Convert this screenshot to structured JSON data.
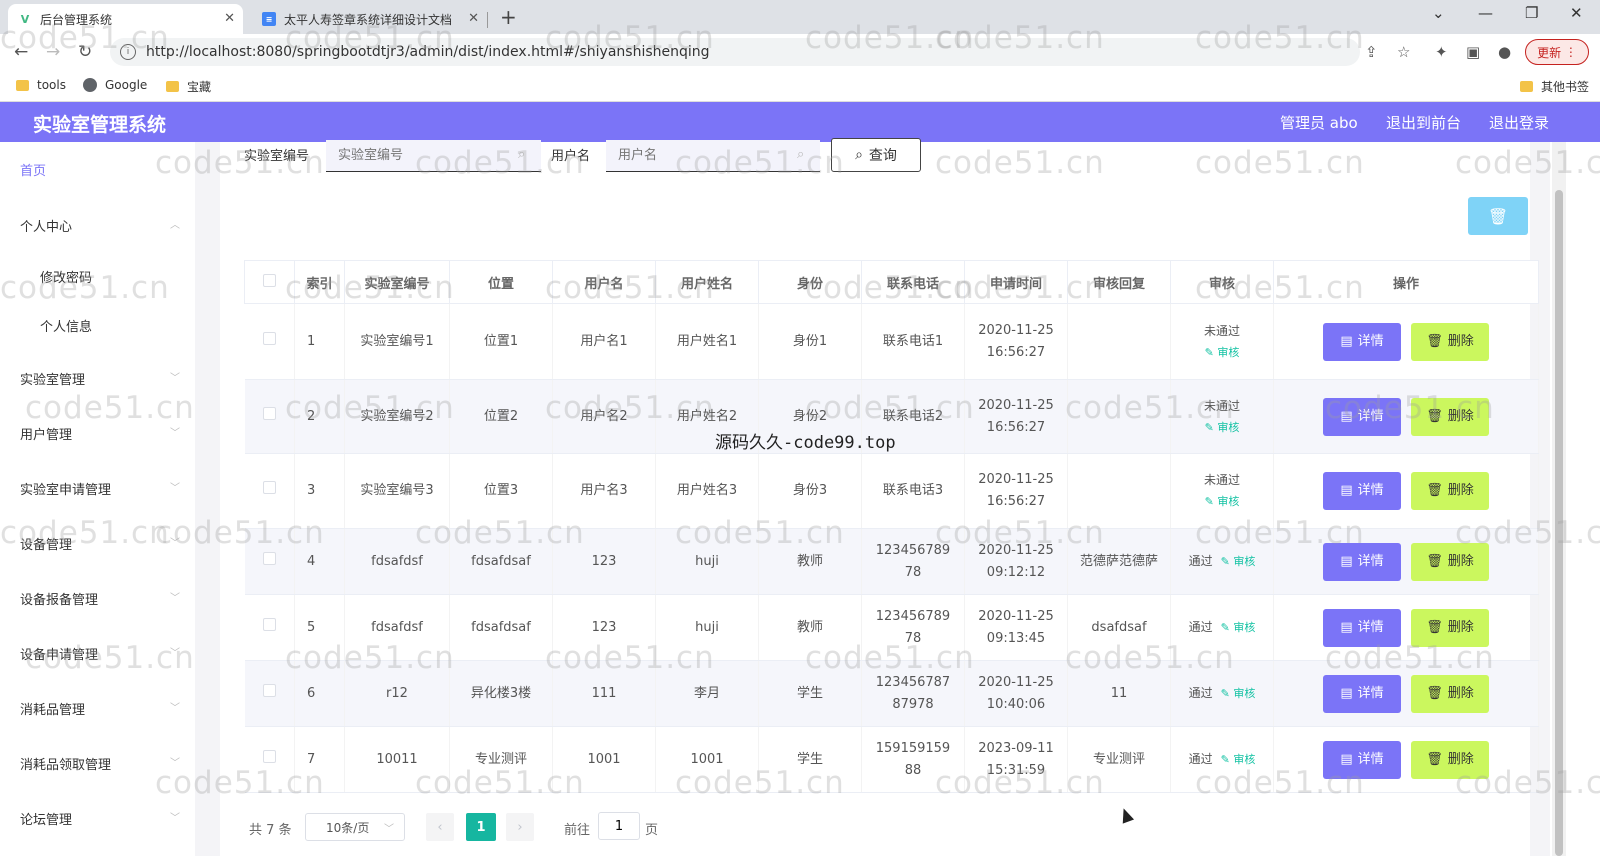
{
  "browser": {
    "tabs": [
      {
        "title": "后台管理系统",
        "active": true
      },
      {
        "title": "太平人寿签章系统详细设计文档",
        "active": false
      }
    ],
    "url": "http://localhost:8080/springbootdtjr3/admin/dist/index.html#/shiyanshishenqing",
    "update_label": "更新",
    "bookmarks": [
      "tools",
      "Google",
      "宝藏"
    ],
    "other_bookmarks": "其他书签"
  },
  "header": {
    "title": "实验室管理系统",
    "user": "管理员 abo",
    "back_to_front": "退出到前台",
    "logout": "退出登录"
  },
  "sidebar": {
    "items": [
      {
        "label": "首页",
        "active": true
      },
      {
        "label": "个人中心"
      },
      {
        "label": "修改密码",
        "sub": true
      },
      {
        "label": "个人信息",
        "sub": true
      },
      {
        "label": "实验室管理"
      },
      {
        "label": "用户管理"
      },
      {
        "label": "实验室申请管理"
      },
      {
        "label": "设备管理"
      },
      {
        "label": "设备报备管理"
      },
      {
        "label": "设备申请管理"
      },
      {
        "label": "消耗品管理"
      },
      {
        "label": "消耗品领取管理"
      },
      {
        "label": "论坛管理"
      }
    ]
  },
  "search": {
    "lab_label": "实验室编号",
    "lab_placeholder": "实验室编号",
    "user_label": "用户名",
    "user_placeholder": "用户名",
    "query_label": "查询"
  },
  "table": {
    "columns": [
      "索引",
      "实验室编号",
      "位置",
      "用户名",
      "用户姓名",
      "身份",
      "联系电话",
      "申请时间",
      "审核回复",
      "审核",
      "操作"
    ],
    "review_action": "审核",
    "detail_label": "详情",
    "delete_label": "删除",
    "rows": [
      {
        "index": "1",
        "lab": "实验室编号1",
        "location": "位置1",
        "username": "用户名1",
        "name": "用户姓名1",
        "identity": "身份1",
        "phone": "联系电话1",
        "time": "2020-11-25 16:56:27",
        "reply": "",
        "status": "未通过"
      },
      {
        "index": "2",
        "lab": "实验室编号2",
        "location": "位置2",
        "username": "用户名2",
        "name": "用户姓名2",
        "identity": "身份2",
        "phone": "联系电话2",
        "time": "2020-11-25 16:56:27",
        "reply": "",
        "status": "未通过"
      },
      {
        "index": "3",
        "lab": "实验室编号3",
        "location": "位置3",
        "username": "用户名3",
        "name": "用户姓名3",
        "identity": "身份3",
        "phone": "联系电话3",
        "time": "2020-11-25 16:56:27",
        "reply": "",
        "status": "未通过"
      },
      {
        "index": "4",
        "lab": "fdsafdsf",
        "location": "fdsafdsaf",
        "username": "123",
        "name": "huji",
        "identity": "教师",
        "phone": "12345678978",
        "time": "2020-11-25 09:12:12",
        "reply": "范德萨范德萨",
        "status": "通过"
      },
      {
        "index": "5",
        "lab": "fdsafdsf",
        "location": "fdsafdsaf",
        "username": "123",
        "name": "huji",
        "identity": "教师",
        "phone": "12345678978",
        "time": "2020-11-25 09:13:45",
        "reply": "dsafdsaf",
        "status": "通过"
      },
      {
        "index": "6",
        "lab": "r12",
        "location": "异化楼3楼",
        "username": "111",
        "name": "李月",
        "identity": "学生",
        "phone": "12345678787978",
        "time": "2020-11-25 10:40:06",
        "reply": "11",
        "status": "通过"
      },
      {
        "index": "7",
        "lab": "10011",
        "location": "专业测评",
        "username": "1001",
        "name": "1001",
        "identity": "学生",
        "phone": "15915915988",
        "time": "2023-09-11 15:31:59",
        "reply": "专业测评",
        "status": "通过"
      }
    ]
  },
  "pagination": {
    "total": "共 7 条",
    "page_size": "10条/页",
    "current_page": "1",
    "goto_prefix": "前往",
    "goto_value": "1",
    "goto_suffix": "页"
  },
  "watermark": {
    "text": "code51.cn",
    "center_text": "源码久久-code99.top"
  }
}
